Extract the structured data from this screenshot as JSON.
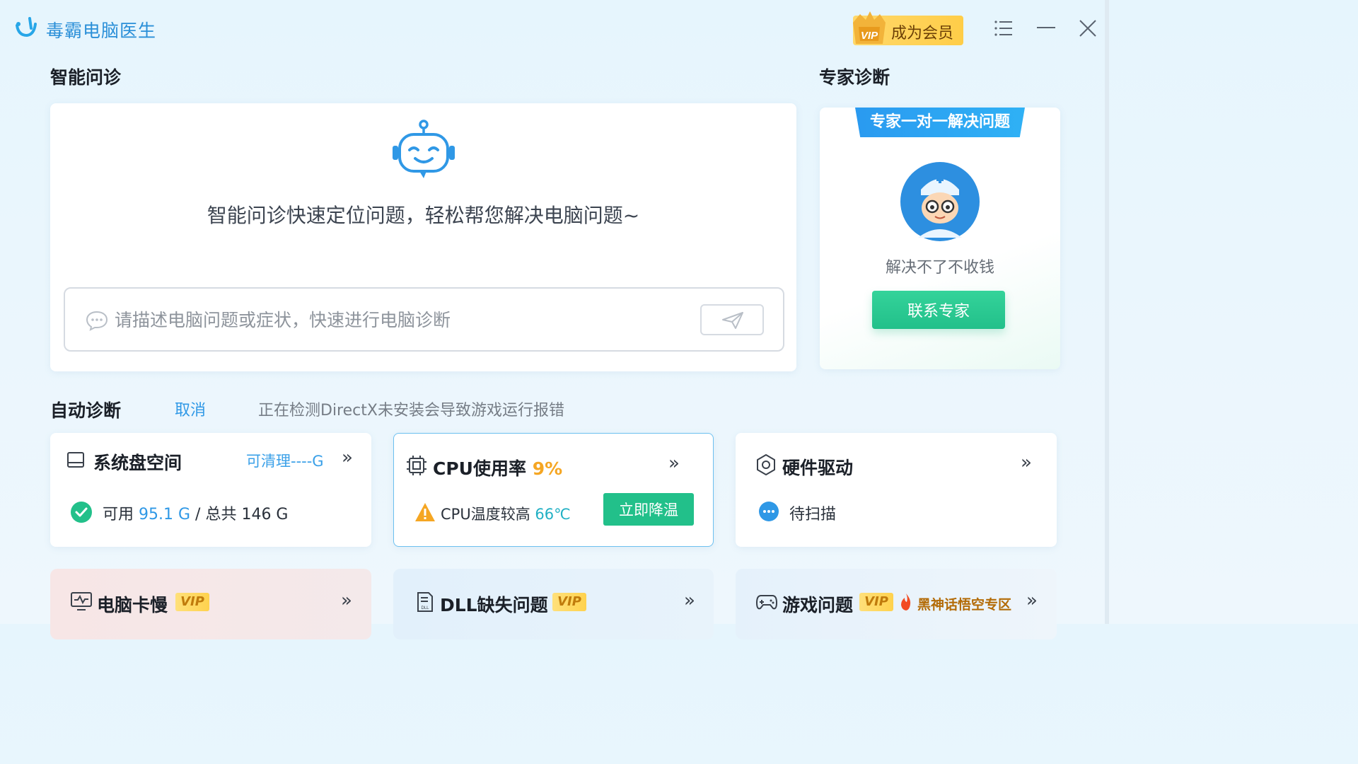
{
  "app": {
    "title": "毒霸电脑医生"
  },
  "header": {
    "vip_button_label": "成为会员",
    "vip_badge_text": "VIP"
  },
  "ask": {
    "section_title": "智能问诊",
    "tagline": "智能问诊快速定位问题，轻松帮您解决电脑问题~",
    "placeholder": "请描述电脑问题或症状，快速进行电脑诊断",
    "value": ""
  },
  "expert": {
    "section_title": "专家诊断",
    "ribbon": "专家一对一解决问题",
    "subtitle": "解决不了不收钱",
    "contact_label": "联系专家"
  },
  "auto": {
    "section_title": "自动诊断",
    "cancel_label": "取消",
    "status_text": "正在检测DirectX未安装会导致游戏运行报错"
  },
  "tiles": {
    "disk": {
      "title": "系统盘空间",
      "clean_label": "可清理----G",
      "available_prefix": "可用",
      "available_value": "95.1 G",
      "total_text": "/ 总共 146 G"
    },
    "cpu": {
      "title": "CPU使用率",
      "usage": "9%",
      "temp_prefix": "CPU温度较高",
      "temp_value": "66℃",
      "cool_label": "立即降温"
    },
    "hardware": {
      "title": "硬件驱动",
      "status": "待扫描"
    }
  },
  "bottom_tiles": {
    "slow": {
      "title": "电脑卡慢",
      "vip": "VIP"
    },
    "dll": {
      "title": "DLL缺失问题",
      "vip": "VIP"
    },
    "game": {
      "title": "游戏问题",
      "vip": "VIP",
      "promo": "黑神话悟空专区"
    }
  },
  "colors": {
    "brand_blue": "#2f98e6",
    "accent_green": "#22c08a",
    "warning_orange": "#f5a623",
    "vip_gold": "#ffd24e"
  },
  "icons": {
    "logo": "app-logo-icon",
    "menu": "hamburger-menu-icon",
    "minimize": "minimize-icon",
    "close": "close-icon",
    "robot": "robot-icon",
    "chat": "chat-bubble-icon",
    "send": "send-icon",
    "disk": "drive-icon",
    "cpu": "chip-icon",
    "hardware": "gear-icon",
    "slow": "monitor-pulse-icon",
    "dll": "document-dll-icon",
    "game": "gamepad-icon"
  }
}
